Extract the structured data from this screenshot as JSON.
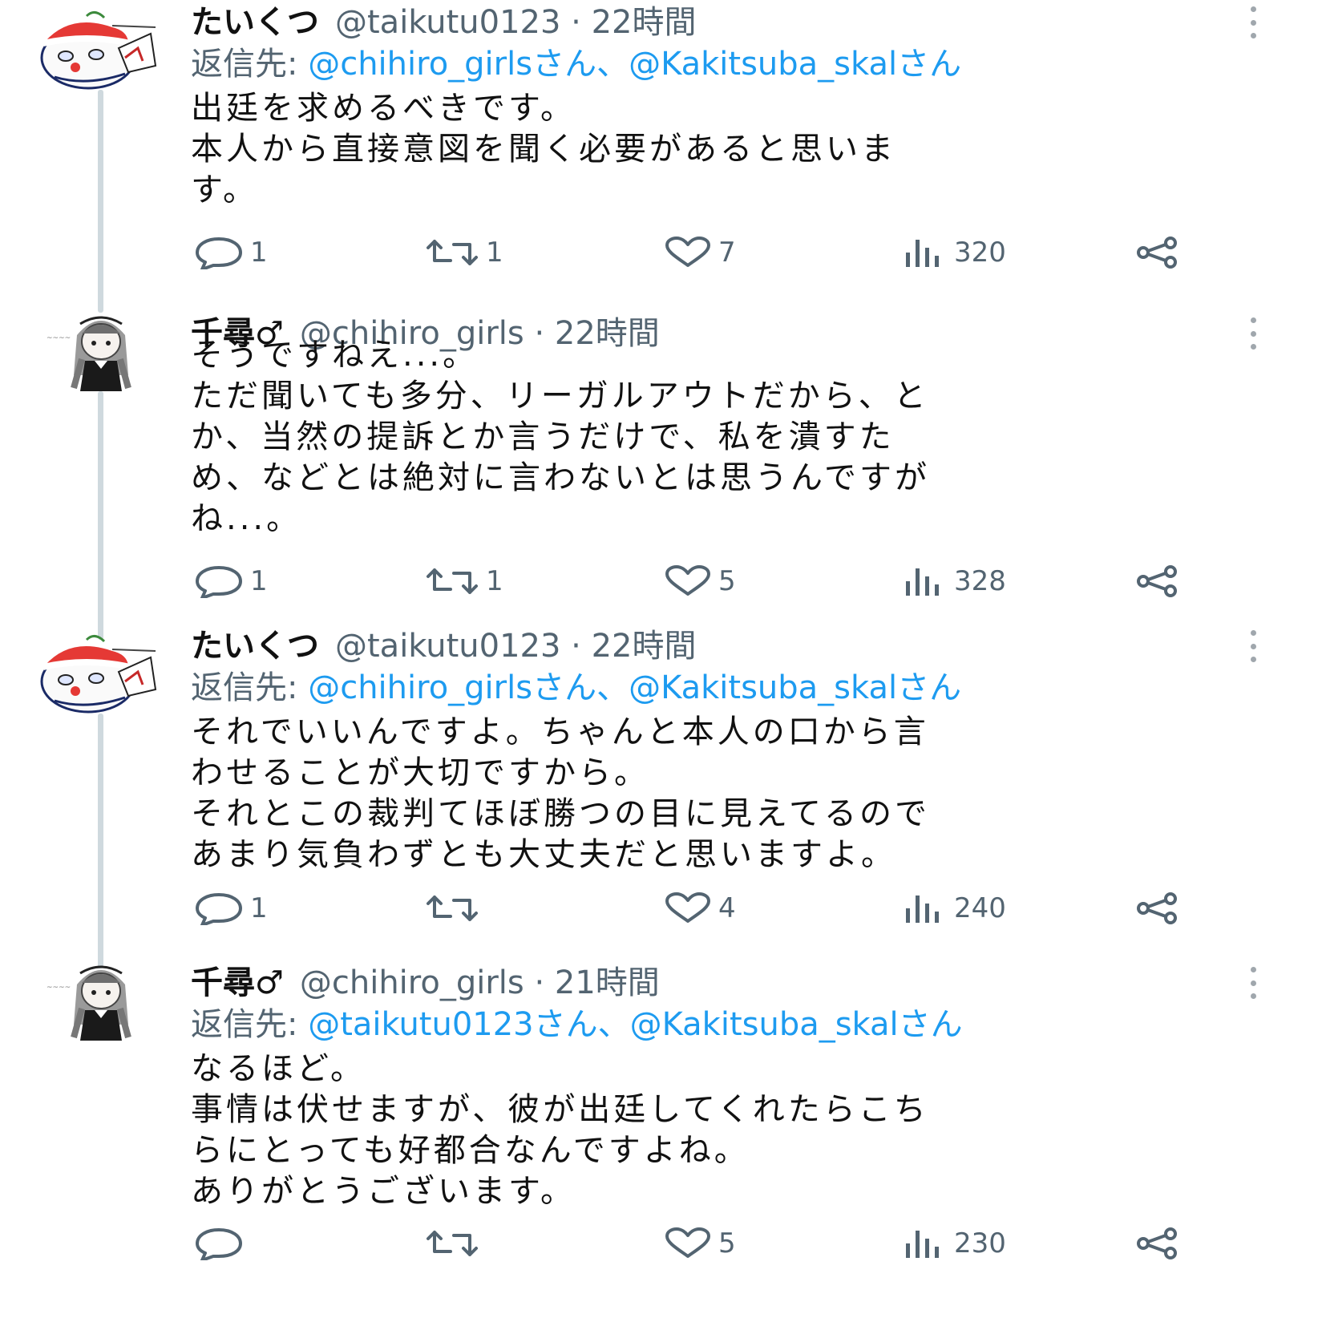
{
  "colors": {
    "text": "#111111",
    "muted": "#536471",
    "link": "#1d9bf0",
    "thread_line": "#cfd9de"
  },
  "tweets": [
    {
      "name": "たいくつ",
      "handle": "@taikutu0123",
      "separator": "·",
      "time": "22時間",
      "avatar": "santa-hat-cartoon-avatar",
      "reply_to": {
        "prefix": "返信先:",
        "mentions": "@chihiro_girlsさん、@Kakitsuba_skalさん"
      },
      "lines": [
        "出廷を求めるべきです。",
        "本人から直接意図を聞く必要があると思いま",
        "す。"
      ],
      "stats": {
        "replies": "1",
        "retweets": "1",
        "likes": "7",
        "views": "320"
      }
    },
    {
      "name": "千尋♂",
      "handle": "@chihiro_girls",
      "separator": "·",
      "time": "22時間",
      "avatar": "anime-girl-avatar",
      "reply_to": null,
      "lines": [
        "そうですねえ...。",
        "ただ聞いても多分、リーガルアウトだから、と",
        "か、当然の提訴とか言うだけで、私を潰すた",
        "め、などとは絶対に言わないとは思うんですが",
        "ね...。"
      ],
      "stats": {
        "replies": "1",
        "retweets": "1",
        "likes": "5",
        "views": "328"
      }
    },
    {
      "name": "たいくつ",
      "handle": "@taikutu0123",
      "separator": "·",
      "time": "22時間",
      "avatar": "santa-hat-cartoon-avatar",
      "reply_to": {
        "prefix": "返信先:",
        "mentions": "@chihiro_girlsさん、@Kakitsuba_skalさん"
      },
      "lines": [
        "それでいいんですよ。ちゃんと本人の口から言",
        "わせることが大切ですから。",
        "それとこの裁判てほぼ勝つの目に見えてるので",
        "あまり気負わずとも大丈夫だと思いますよ。"
      ],
      "stats": {
        "replies": "1",
        "retweets": "",
        "likes": "4",
        "views": "240"
      }
    },
    {
      "name": "千尋♂",
      "handle": "@chihiro_girls",
      "separator": "·",
      "time": "21時間",
      "avatar": "anime-girl-avatar",
      "reply_to": {
        "prefix": "返信先:",
        "mentions": "@taikutu0123さん、@Kakitsuba_skalさん"
      },
      "lines": [
        "なるほど。",
        "事情は伏せますが、彼が出廷してくれたらこち",
        "らにとっても好都合なんですよね。",
        "ありがとうございます。"
      ],
      "stats": {
        "replies": "",
        "retweets": "",
        "likes": "5",
        "views": "230"
      }
    }
  ]
}
